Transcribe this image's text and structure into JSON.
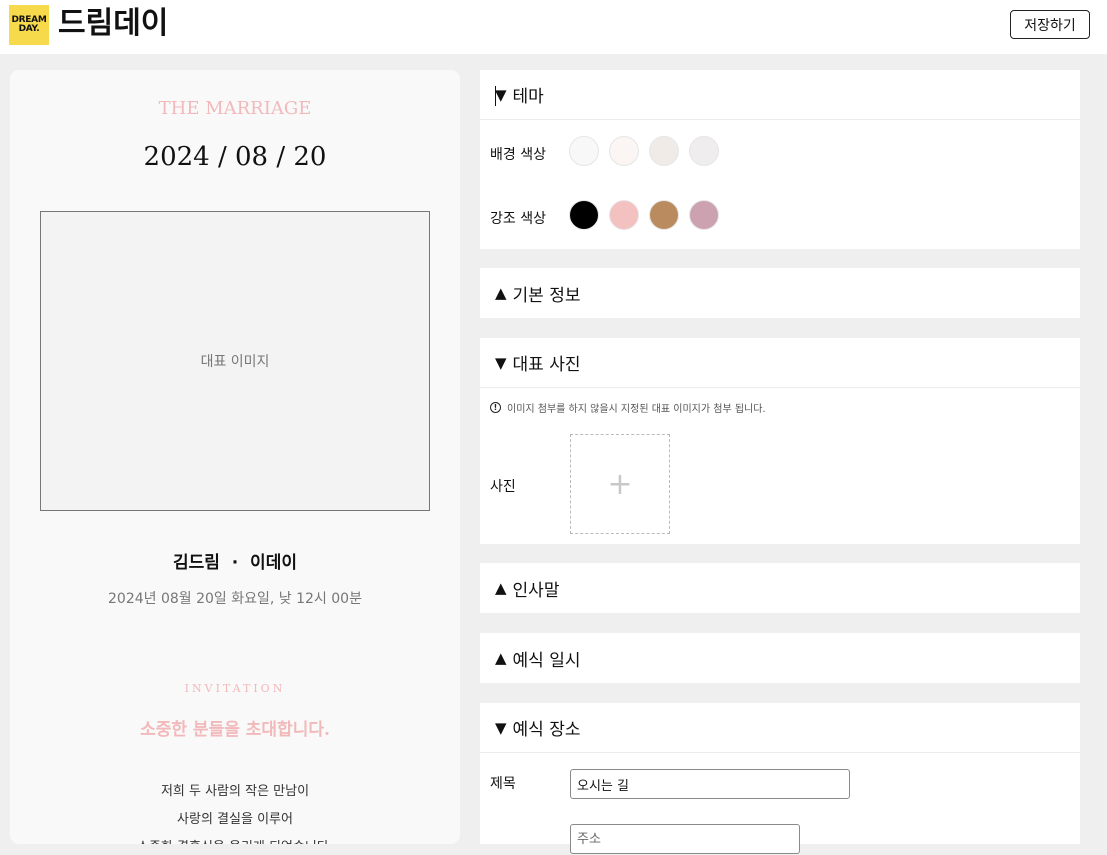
{
  "header": {
    "logo_line1": "DREAM",
    "logo_line2": "DAY.",
    "brand": "드림데이",
    "save_label": "저장하기"
  },
  "preview": {
    "marriage": "THE MARRIAGE",
    "date": "2024 / 08 / 20",
    "image_placeholder": "대표 이미지",
    "names": "김드림  ·  이데이",
    "datetime": "2024년 08월 20일 화요일, 낮 12시 00분",
    "invitation": "INVITATION",
    "invite_title": "소중한 분들을 초대합니다.",
    "message": [
      "저희 두 사람의 작은 만남이",
      "사랑의 결실을 이루어",
      "소중한 결혼식을 올리게 되었습니다."
    ]
  },
  "panels": {
    "theme": {
      "arrow": "▼",
      "title": "테마",
      "bg_label": "배경 색상",
      "accent_label": "강조 색상",
      "bg_colors": [
        "#f8f8f8",
        "#fbf5f4",
        "#f0ebe6",
        "#efeded"
      ],
      "accent_colors": [
        "#000000",
        "#f4c1c1",
        "#b98b5e",
        "#cda2b0"
      ]
    },
    "basic_info": {
      "arrow": "▲",
      "title": "기본 정보"
    },
    "main_photo": {
      "arrow": "▼",
      "title": "대표 사진",
      "notice": "이미지 첨부를 하지 않을시 지정된 대표 이미지가 첨부 됩니다.",
      "photo_label": "사진",
      "add_symbol": "+"
    },
    "greeting": {
      "arrow": "▲",
      "title": "인사말"
    },
    "wedding_datetime": {
      "arrow": "▲",
      "title": "예식 일시"
    },
    "wedding_venue": {
      "arrow": "▼",
      "title": "예식 장소",
      "title_label": "제목",
      "title_value": "오시는 길",
      "address_placeholder": "주소"
    }
  }
}
